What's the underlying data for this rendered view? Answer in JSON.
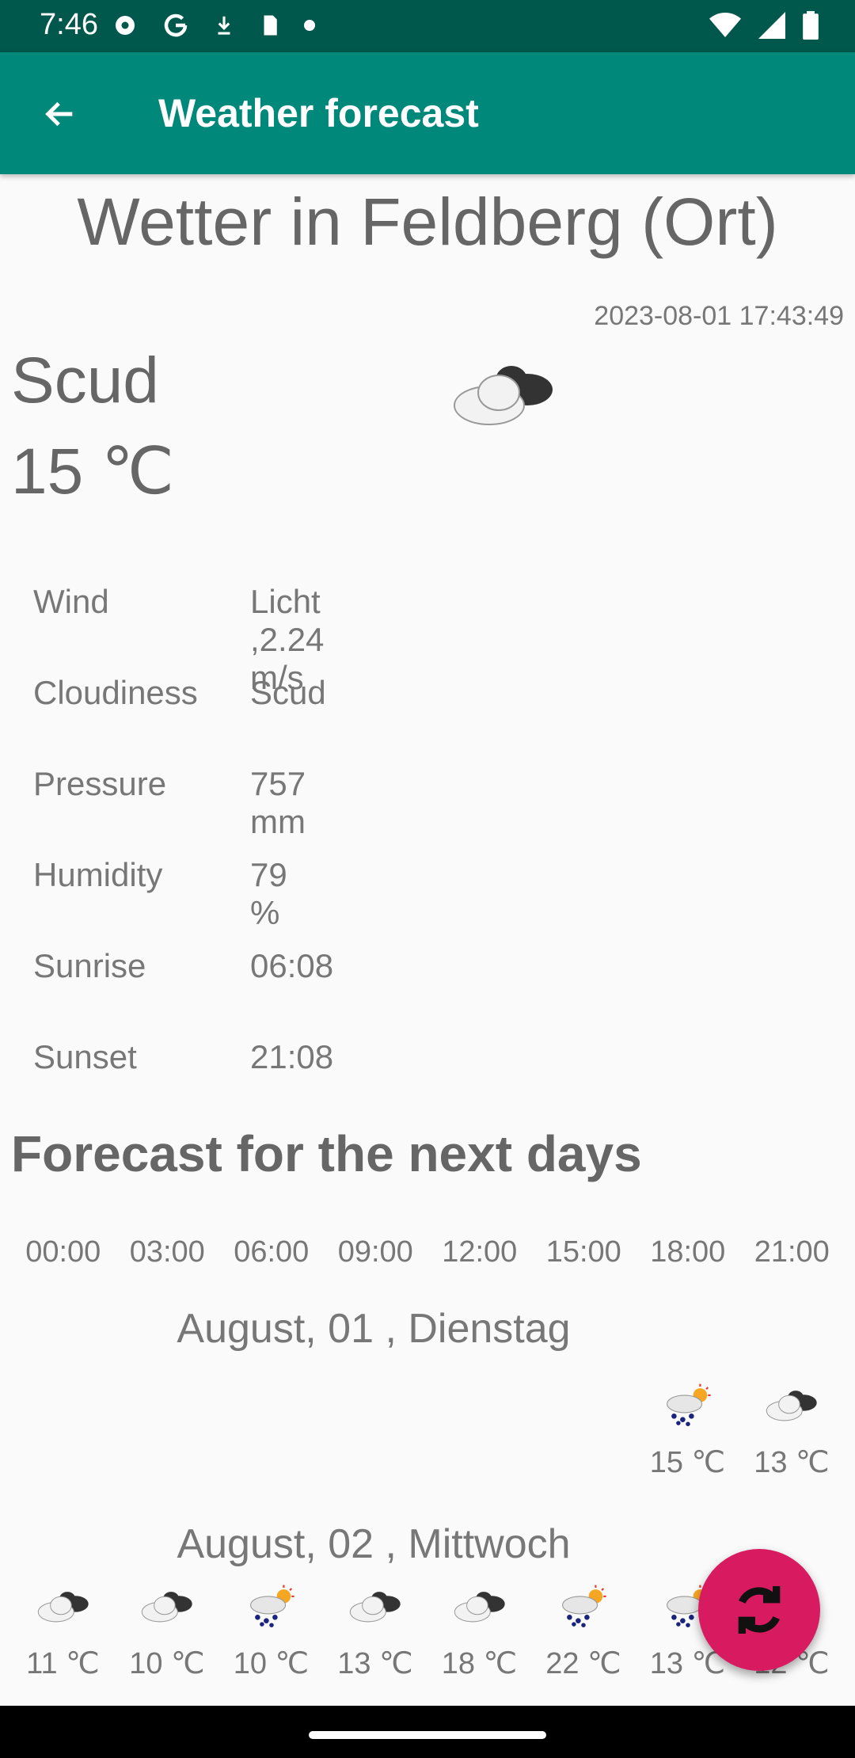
{
  "status_bar": {
    "time": "7:46"
  },
  "app_bar": {
    "title": "Weather forecast"
  },
  "current": {
    "place_title": "Wetter in Feldberg (Ort)",
    "timestamp": "2023-08-01 17:43:49",
    "condition": "Scud",
    "temperature": "15 ℃",
    "icon": "cloud-icon"
  },
  "details": [
    {
      "label": "Wind",
      "value": "Licht ,2.24 m/s"
    },
    {
      "label": "Cloudiness",
      "value": "Scud"
    },
    {
      "label": "Pressure",
      "value": "757 mm"
    },
    {
      "label": "Humidity",
      "value": "79 %"
    },
    {
      "label": "Sunrise",
      "value": "06:08"
    },
    {
      "label": "Sunset",
      "value": "21:08"
    }
  ],
  "forecast": {
    "title": "Forecast for the next days",
    "hours": [
      "00:00",
      "03:00",
      "06:00",
      "09:00",
      "12:00",
      "15:00",
      "18:00",
      "21:00"
    ],
    "days": [
      {
        "title": "August, 01 , Dienstag",
        "slots": [
          {
            "hour": "18:00",
            "icon": "rain-sun-icon",
            "temp": "15 ℃"
          },
          {
            "hour": "21:00",
            "icon": "cloud-icon",
            "temp": "13 ℃"
          }
        ]
      },
      {
        "title": "August, 02 , Mittwoch",
        "slots": [
          {
            "hour": "00:00",
            "icon": "cloud-icon",
            "temp": "11 ℃"
          },
          {
            "hour": "03:00",
            "icon": "cloud-icon",
            "temp": "10 ℃"
          },
          {
            "hour": "06:00",
            "icon": "rain-sun-icon",
            "temp": "10 ℃"
          },
          {
            "hour": "09:00",
            "icon": "cloud-icon",
            "temp": "13 ℃"
          },
          {
            "hour": "12:00",
            "icon": "cloud-icon",
            "temp": "18 ℃"
          },
          {
            "hour": "15:00",
            "icon": "rain-sun-icon",
            "temp": "22 ℃"
          },
          {
            "hour": "18:00",
            "icon": "rain-sun-icon",
            "temp": "13 ℃"
          },
          {
            "hour": "21:00",
            "icon": "cloud-icon",
            "temp": "12 ℃"
          }
        ]
      }
    ]
  },
  "fab": {
    "icon": "refresh-icon"
  }
}
